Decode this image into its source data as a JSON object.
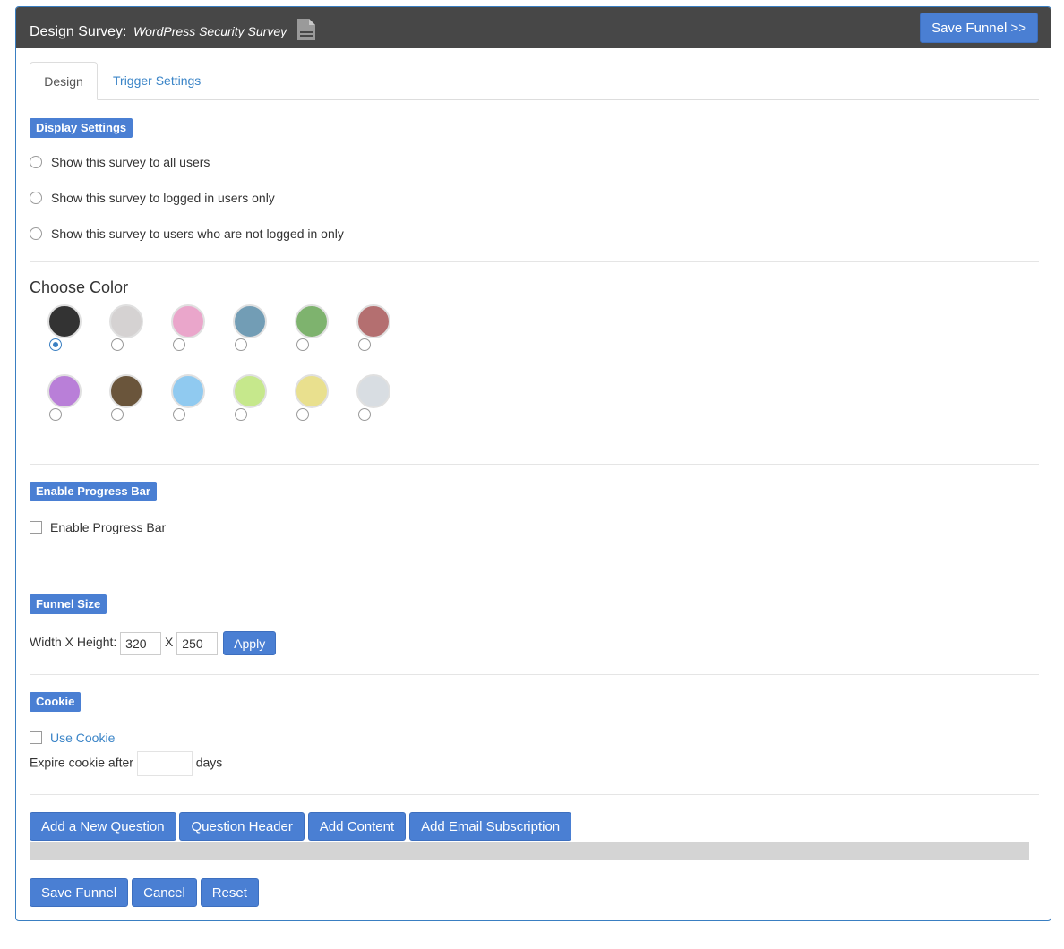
{
  "header": {
    "title": "Design Survey:",
    "survey_name": "WordPress Security Survey",
    "save_button": "Save Funnel >>",
    "icon": "document-icon"
  },
  "tabs": [
    {
      "label": "Design",
      "active": true
    },
    {
      "label": "Trigger Settings",
      "active": false
    }
  ],
  "display_settings": {
    "badge": "Display Settings",
    "options": [
      {
        "label": "Show this survey to all users",
        "checked": false
      },
      {
        "label": "Show this survey to logged in users only",
        "checked": false
      },
      {
        "label": "Show this survey to users who are not logged in only",
        "checked": false
      }
    ]
  },
  "choose_color": {
    "title": "Choose Color",
    "colors": [
      "#333333",
      "#d5d2d2",
      "#eaa6cb",
      "#729db5",
      "#7eb36e",
      "#b46f70",
      "#b97fd8",
      "#6a553b",
      "#90caf0",
      "#c6e88c",
      "#e9e08e",
      "#d8dde2"
    ],
    "selected_index": 0
  },
  "progress_bar": {
    "badge": "Enable Progress Bar",
    "checkbox_label": "Enable Progress Bar"
  },
  "funnel_size": {
    "badge": "Funnel Size",
    "label": "Width X Height:",
    "width": "320",
    "separator": "X",
    "height": "250",
    "apply": "Apply"
  },
  "cookie": {
    "badge": "Cookie",
    "use_cookie": "Use Cookie",
    "expire_label": "Expire cookie after",
    "expire_value": "",
    "days": "days"
  },
  "actions": {
    "add_question": "Add a New Question",
    "question_header": "Question Header",
    "add_content": "Add Content",
    "add_email": "Add Email Subscription"
  },
  "footer": {
    "save": "Save Funnel",
    "cancel": "Cancel",
    "reset": "Reset"
  }
}
